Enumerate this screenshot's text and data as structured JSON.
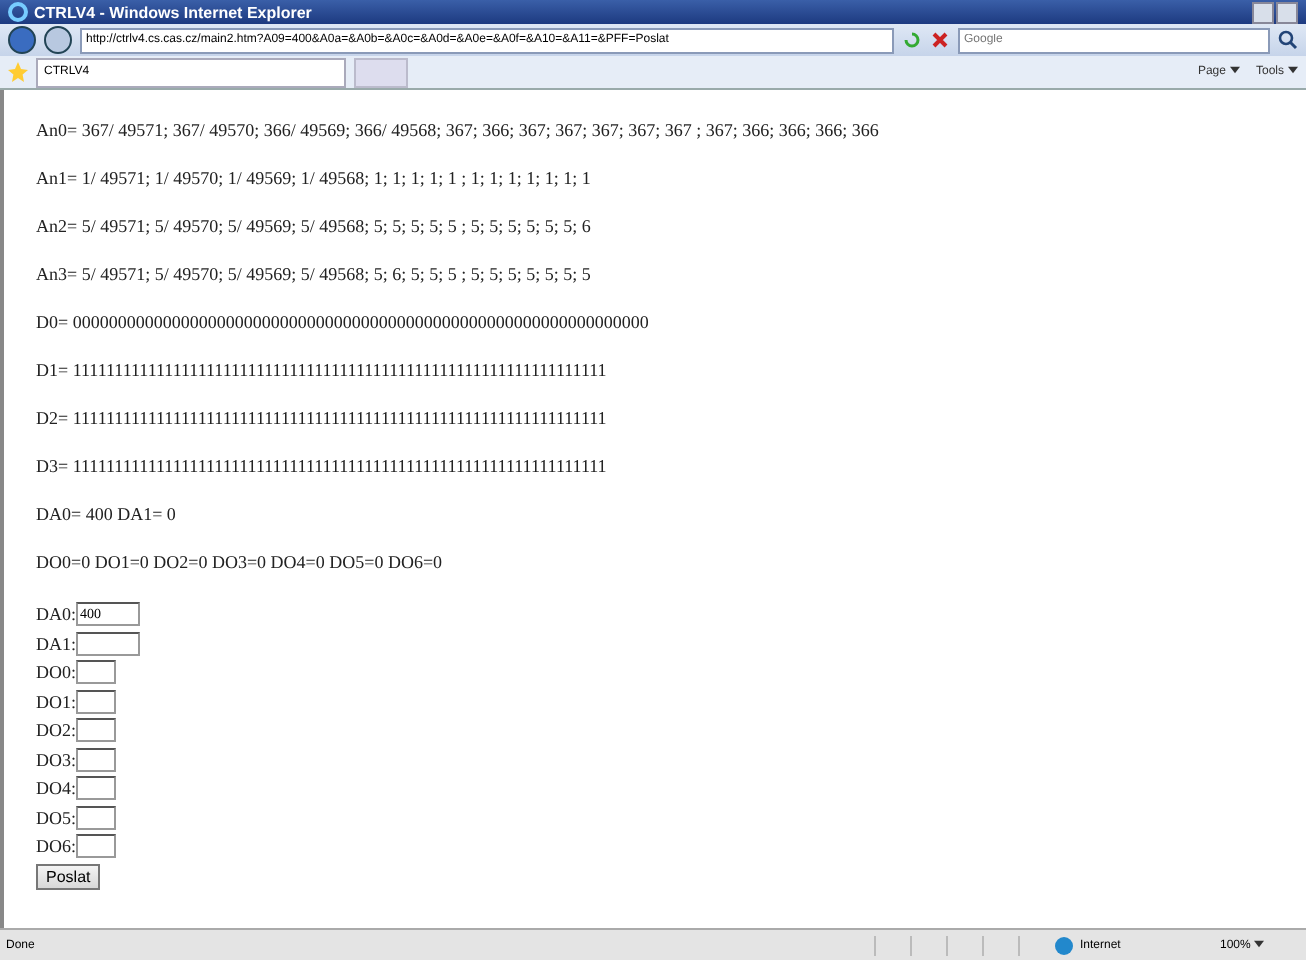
{
  "window": {
    "title": "CTRLV4 - Windows Internet Explorer"
  },
  "address_bar": {
    "url": "http://ctrlv4.cs.cas.cz/main2.htm?A09=400&A0a=&A0b=&A0c=&A0d=&A0e=&A0f=&A10=&A11=&PFF=Poslat",
    "search_placeholder": "Google"
  },
  "tab": {
    "label": "CTRLV4"
  },
  "command_bar": [
    "Page",
    "Tools"
  ],
  "lines": [
    "An0= 367/ 49571; 367/ 49570; 366/ 49569; 366/ 49568; 367; 366; 367; 367; 367; 367; 367 ; 367; 366; 366; 366; 366",
    "An1= 1/ 49571; 1/ 49570; 1/ 49569; 1/ 49568; 1; 1; 1; 1; 1 ; 1; 1; 1; 1; 1; 1; 1",
    "An2= 5/ 49571; 5/ 49570; 5/ 49569; 5/ 49568; 5; 5; 5; 5; 5 ; 5; 5; 5; 5; 5; 5; 6",
    "An3= 5/ 49571; 5/ 49570; 5/ 49569; 5/ 49568; 5; 6; 5; 5; 5 ; 5; 5; 5; 5; 5; 5; 5",
    "D0= 0000000000000000000000000000000000000000000000000000000000000000",
    "D1= 1111111111111111111111111111111111111111111111111111111111111111",
    "D2= 1111111111111111111111111111111111111111111111111111111111111111",
    "D3= 1111111111111111111111111111111111111111111111111111111111111111",
    "DA0= 400 DA1= 0",
    "DO0=0 DO1=0 DO2=0 DO3=0 DO4=0 DO5=0 DO6=0"
  ],
  "form": [
    {
      "label": "DA0:",
      "value": "400",
      "kind": "wide"
    },
    {
      "label": "DA1:",
      "kind": "wide"
    },
    {
      "label": "DO0:",
      "kind": "narrow"
    },
    {
      "label": "DO1:",
      "kind": "narrow"
    },
    {
      "label": "DO2:",
      "kind": "narrow"
    },
    {
      "label": "DO3:",
      "kind": "narrow"
    },
    {
      "label": "DO4:",
      "kind": "narrow"
    },
    {
      "label": "DO5:",
      "kind": "narrow"
    },
    {
      "label": "DO6:",
      "kind": "narrow"
    }
  ],
  "submit": "Poslat",
  "status_bar": {
    "status": "Done",
    "zone": "Internet",
    "zoom": "100%"
  }
}
